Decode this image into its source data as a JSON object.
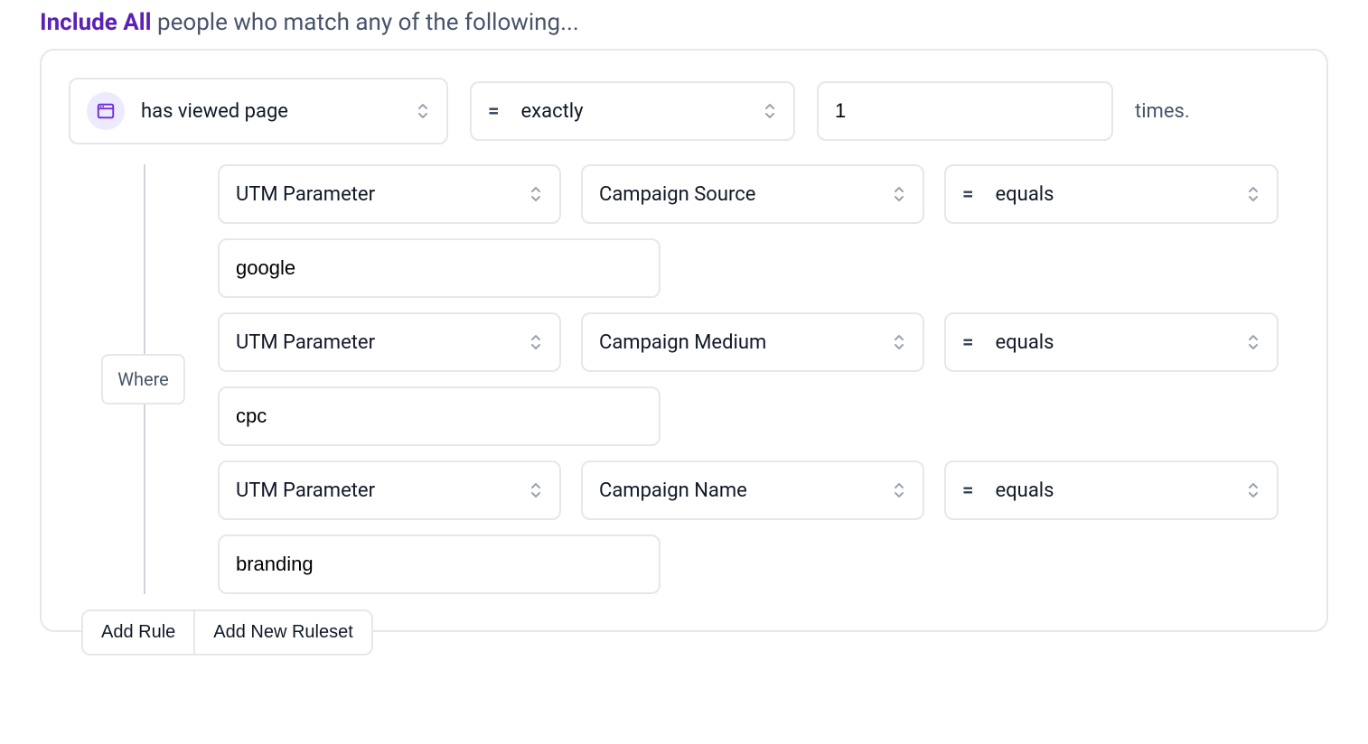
{
  "heading": {
    "accent": "Include All",
    "rest": " people who match any of the following..."
  },
  "rule": {
    "event_label": "has viewed page",
    "comparator_op": "=",
    "comparator_label": "exactly",
    "count_value": "1",
    "times_suffix": "times."
  },
  "where_label": "Where",
  "conditions": [
    {
      "type_label": "UTM Parameter",
      "param_label": "Campaign Source",
      "op_sym": "=",
      "op_label": "equals",
      "value": "google"
    },
    {
      "type_label": "UTM Parameter",
      "param_label": "Campaign Medium",
      "op_sym": "=",
      "op_label": "equals",
      "value": "cpc"
    },
    {
      "type_label": "UTM Parameter",
      "param_label": "Campaign Name",
      "op_sym": "=",
      "op_label": "equals",
      "value": "branding"
    }
  ],
  "footer": {
    "add_rule": "Add Rule",
    "add_new_ruleset": "Add New Ruleset"
  }
}
